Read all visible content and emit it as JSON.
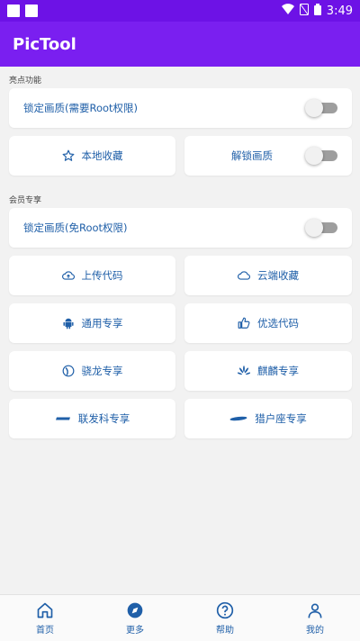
{
  "status_bar": {
    "time": "3:49"
  },
  "app": {
    "title": "PicTool"
  },
  "sections": {
    "highlight_label": "亮点功能",
    "member_label": "会员专享"
  },
  "cards": {
    "lock_quality_root": "锁定画质(需要Root权限)",
    "local_favorites": "本地收藏",
    "unlock_quality": "解锁画质",
    "lock_quality_no_root": "锁定画质(免Root权限)",
    "upload_code": "上传代码",
    "cloud_favorites": "云端收藏",
    "general_exclusive": "通用专享",
    "selected_code": "优选代码",
    "snapdragon_exclusive": "骁龙专享",
    "kirin_exclusive": "麒麟专享",
    "mediatek_exclusive": "联发科专享",
    "exynos_exclusive": "猎户座专享"
  },
  "toggles": {
    "lock_quality_root": false,
    "unlock_quality": false,
    "lock_quality_no_root": false
  },
  "nav": {
    "home": "首页",
    "more": "更多",
    "help": "帮助",
    "mine": "我的"
  },
  "colors": {
    "status_bar": "#6d12e6",
    "app_bar": "#7a1ff0",
    "accent_text": "#1f5fa8",
    "background": "#f2f2f2"
  }
}
